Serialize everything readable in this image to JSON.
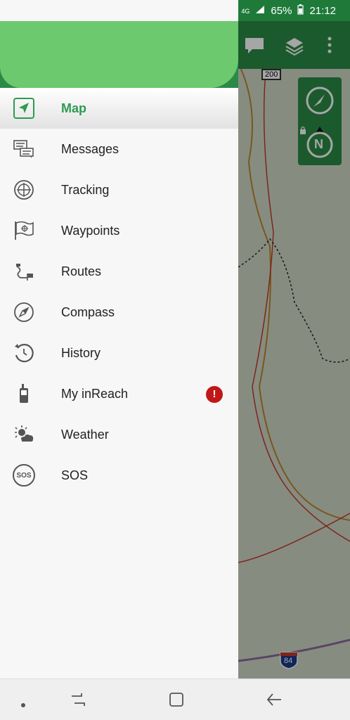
{
  "status_bar": {
    "battery": "65%",
    "time": "21:12",
    "network": "4G"
  },
  "map": {
    "route_200": "200",
    "interstate": "84",
    "compass_north": "N"
  },
  "menu": {
    "items": [
      {
        "label": "Map",
        "icon": "map-navigation-icon"
      },
      {
        "label": "Messages",
        "icon": "messages-icon"
      },
      {
        "label": "Tracking",
        "icon": "tracking-icon"
      },
      {
        "label": "Waypoints",
        "icon": "waypoints-icon"
      },
      {
        "label": "Routes",
        "icon": "routes-icon"
      },
      {
        "label": "Compass",
        "icon": "compass-icon"
      },
      {
        "label": "History",
        "icon": "history-icon"
      },
      {
        "label": "My inReach",
        "icon": "device-icon"
      },
      {
        "label": "Weather",
        "icon": "weather-icon"
      },
      {
        "label": "SOS",
        "icon": "sos-icon"
      }
    ],
    "alert_badge": "!",
    "sos_icon_text": "SOS"
  },
  "colors": {
    "accent": "#2e9b50",
    "header": "#2a8a46",
    "alert": "#c01818"
  }
}
